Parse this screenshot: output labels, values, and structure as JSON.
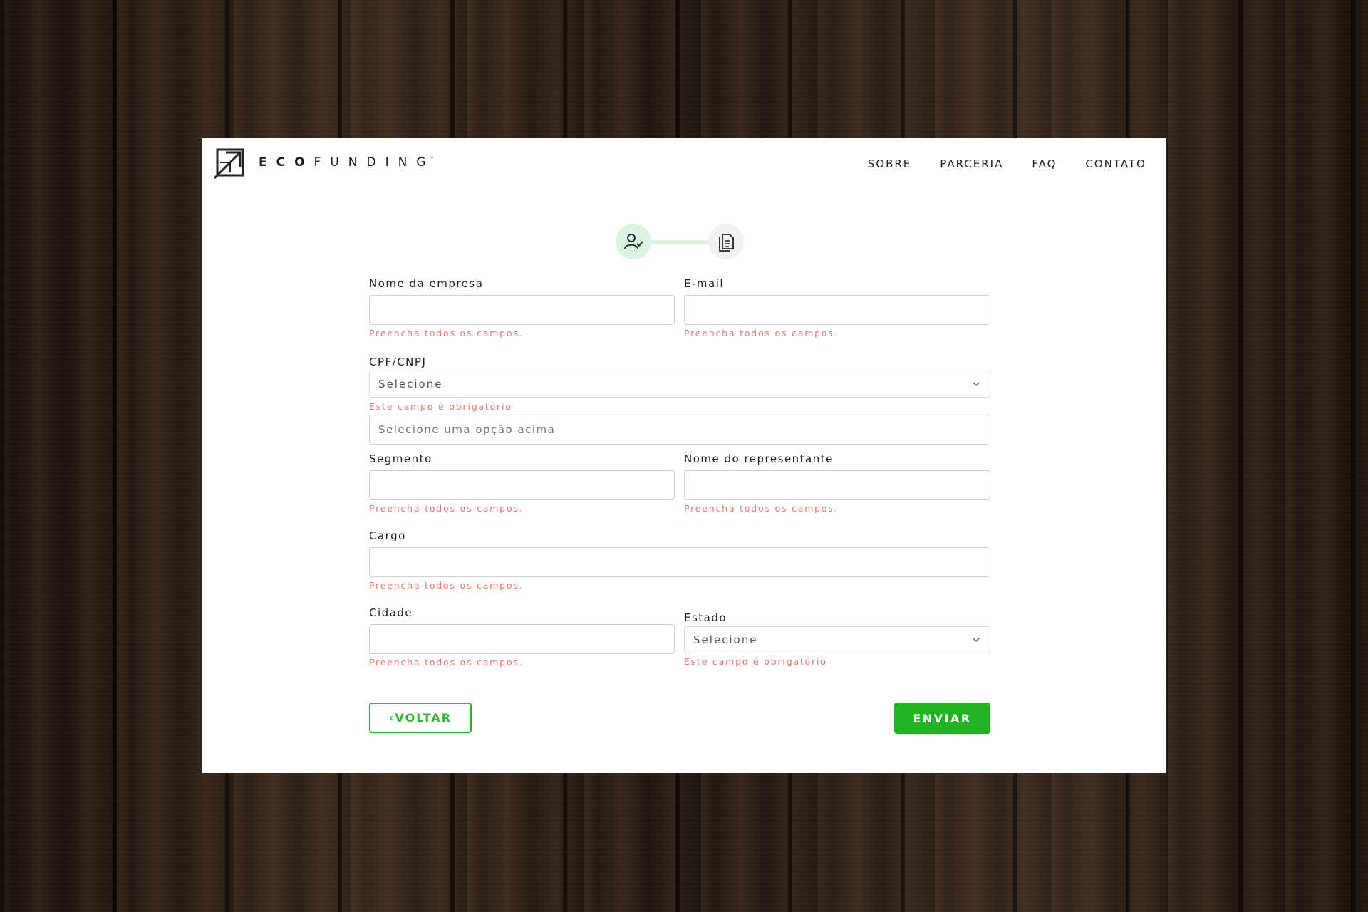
{
  "brand": {
    "eco": "ECO",
    "funding": "FUNDING",
    "tm": "™"
  },
  "nav": [
    "SOBRE",
    "PARCERIA",
    "FAQ",
    "CONTATO"
  ],
  "stepper": {
    "step1_icon": "user-check-icon",
    "step2_icon": "document-icon",
    "current_step": 1
  },
  "form": {
    "company_name": {
      "label": "Nome da empresa",
      "value": "",
      "error": "Preencha todos os campos."
    },
    "email": {
      "label": "E-mail",
      "value": "",
      "error": "Preencha todos os campos."
    },
    "cpf_cnpj": {
      "label": "CPF/CNPJ",
      "selected": "Selecione",
      "error": "Este campo é obrigatório"
    },
    "document_number": {
      "placeholder": "Selecione uma opção acima",
      "value": ""
    },
    "segment": {
      "label": "Segmento",
      "value": "",
      "error": "Preencha todos os campos."
    },
    "representative": {
      "label": "Nome do representante",
      "value": "",
      "error": "Preencha todos os campos."
    },
    "role": {
      "label": "Cargo",
      "value": "",
      "error": "Preencha todos os campos."
    },
    "city": {
      "label": "Cidade",
      "value": "",
      "error": "Preencha todos os campos."
    },
    "state": {
      "label": "Estado",
      "selected": "Selecione",
      "error": "Este campo é obrigatório"
    }
  },
  "buttons": {
    "back_icon": "‹",
    "back": "VOLTAR",
    "send": "ENVIAR"
  },
  "colors": {
    "accent": "#22b322",
    "error": "#e8746f",
    "step_active_bg": "#d9f5e1",
    "text": "#1d1d1d"
  }
}
